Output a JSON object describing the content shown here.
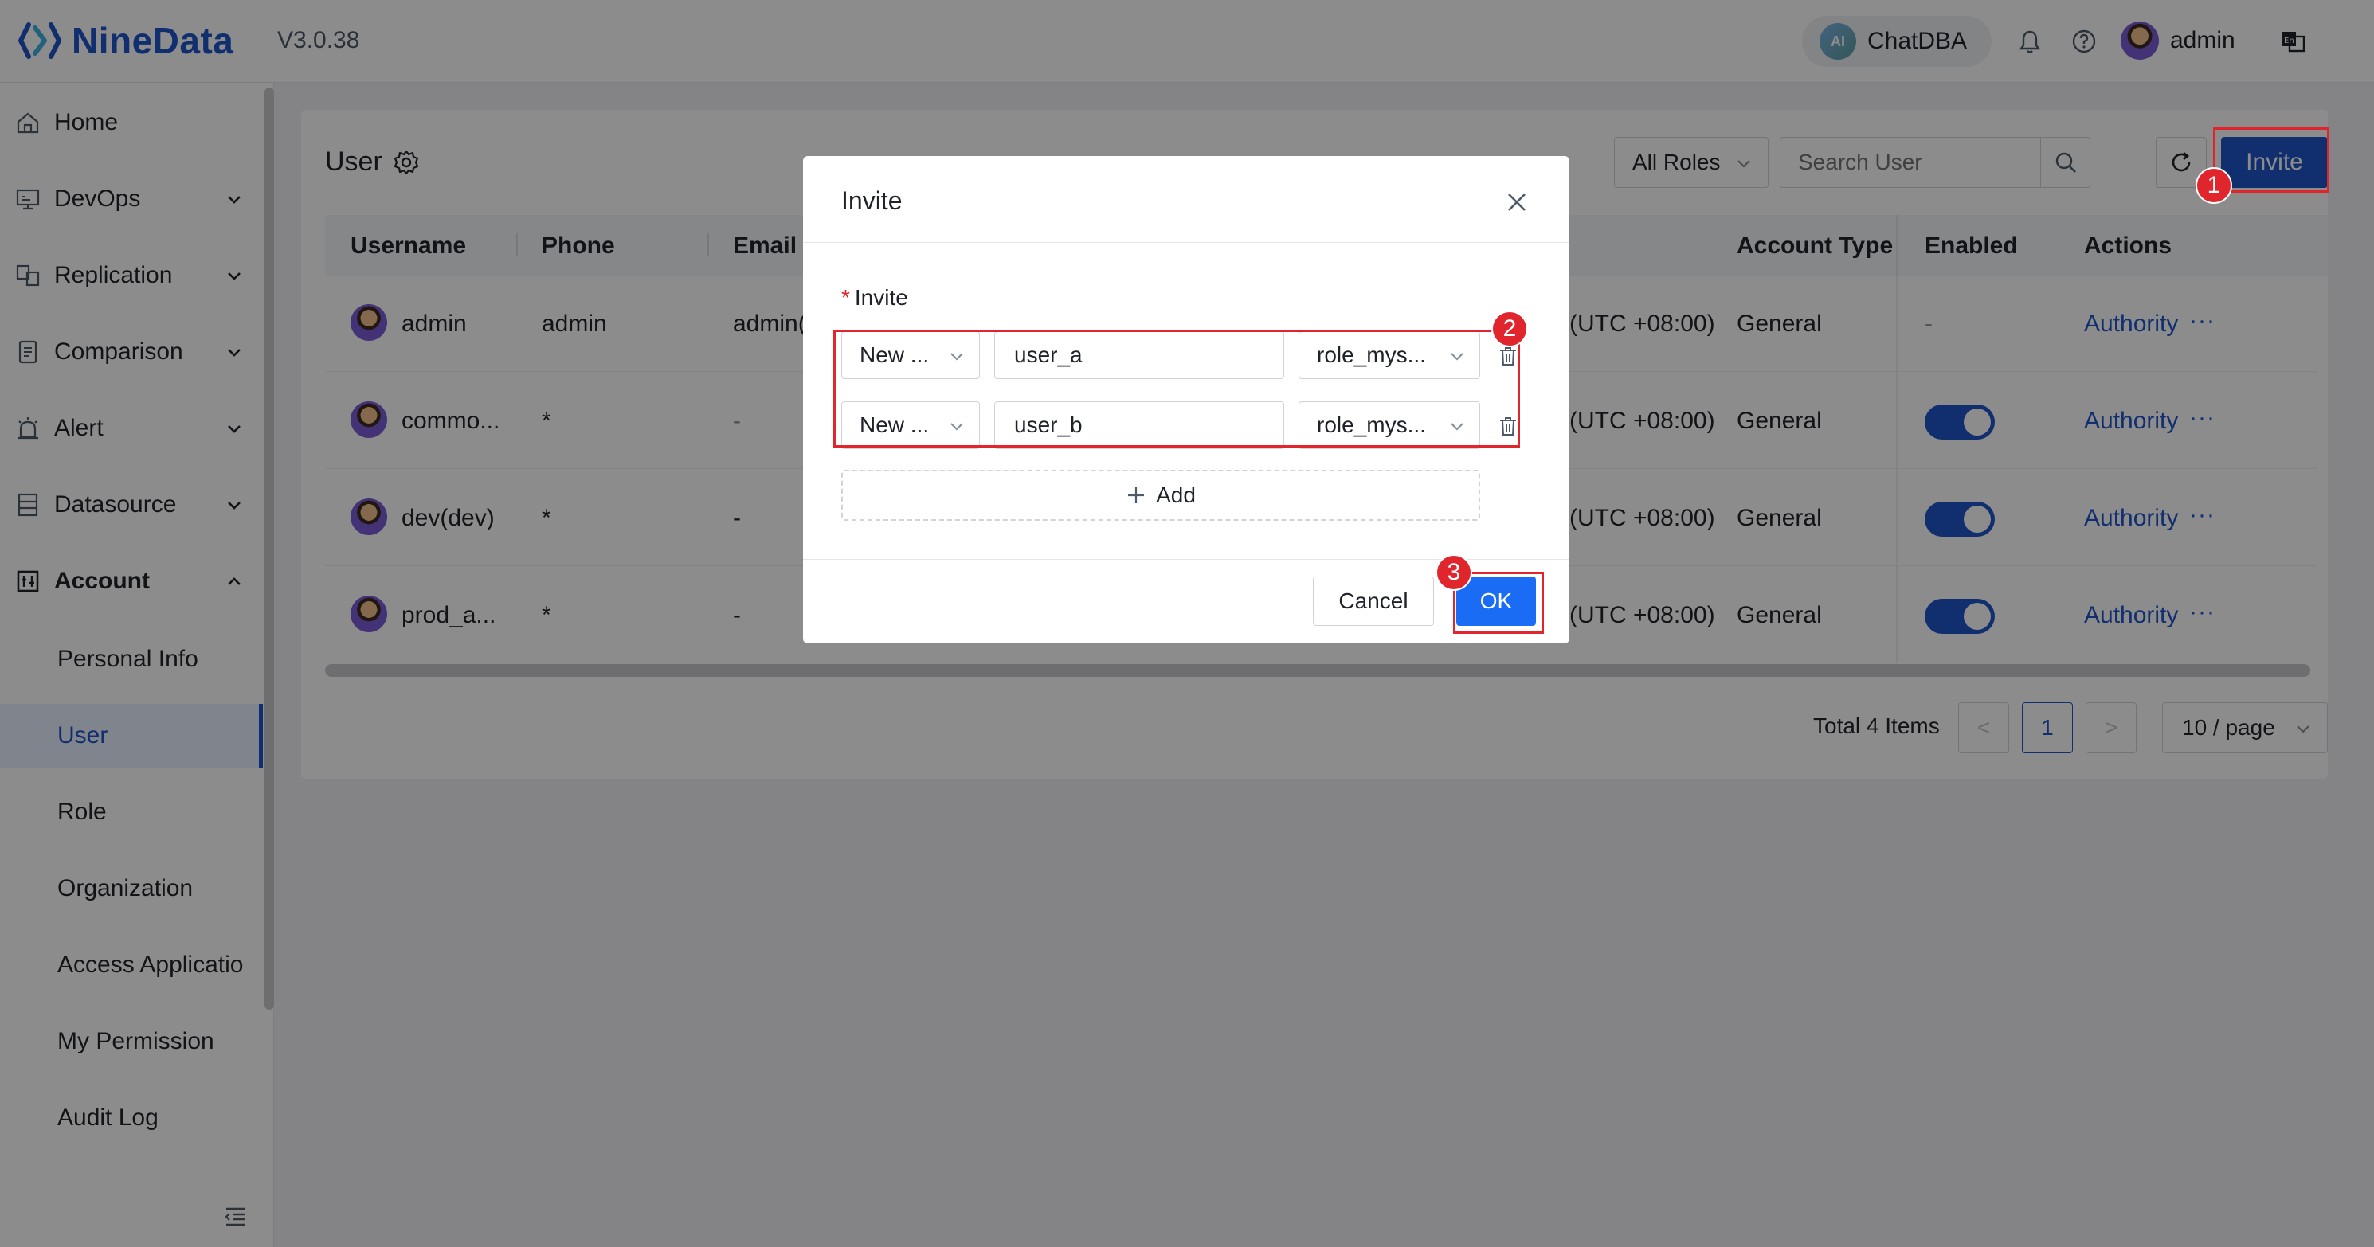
{
  "app": {
    "name": "NineData",
    "version": "V3.0.38",
    "chatdba_badge": "AI",
    "chatdba_label": "ChatDBA",
    "user": "admin",
    "accent": "#1f54c9"
  },
  "sidebar": {
    "items": [
      {
        "label": "Home",
        "icon": "home-icon"
      },
      {
        "label": "DevOps",
        "icon": "monitor-icon"
      },
      {
        "label": "Replication",
        "icon": "replication-icon"
      },
      {
        "label": "Comparison",
        "icon": "comparison-icon"
      },
      {
        "label": "Alert",
        "icon": "alarm-icon"
      },
      {
        "label": "Datasource",
        "icon": "database-icon"
      },
      {
        "label": "Account",
        "icon": "account-icon"
      }
    ],
    "account_sub": [
      "Personal Info",
      "User",
      "Role",
      "Organization",
      "Access Applicatio",
      "My Permission",
      "Audit Log"
    ],
    "active_sub": "User"
  },
  "page": {
    "title": "User",
    "roles_filter": "All Roles",
    "search_placeholder": "Search User",
    "invite_label": "Invite"
  },
  "table": {
    "headers": {
      "username": "Username",
      "phone": "Phone",
      "email": "Email",
      "account_type": "Account Type",
      "enabled": "Enabled",
      "actions": "Actions"
    },
    "rows": [
      {
        "username": "admin",
        "phone": "admin",
        "email": "admin(",
        "time": "(UTC +08:00)",
        "account_type": "General",
        "enabled": "-",
        "action": "Authority",
        "more": "···"
      },
      {
        "username": "commo...",
        "phone": "*",
        "email": "-",
        "time": "(UTC +08:00)",
        "account_type": "General",
        "enabled": true,
        "action": "Authority",
        "more": "···"
      },
      {
        "username": "dev(dev)",
        "phone": "*",
        "email": "-",
        "time": "(UTC +08:00)",
        "account_type": "General",
        "enabled": true,
        "action": "Authority",
        "more": "···"
      },
      {
        "username": "prod_a...",
        "phone": "*",
        "email": "-",
        "time": "(UTC +08:00)",
        "account_type": "General",
        "enabled": true,
        "action": "Authority",
        "more": "···"
      }
    ]
  },
  "pagination": {
    "total": "Total 4 Items",
    "prev": "<",
    "current": "1",
    "next": ">",
    "page_size": "10 / page"
  },
  "modal": {
    "title": "Invite",
    "field_required": "*",
    "field_label": "Invite",
    "rows": [
      {
        "type": "New ...",
        "username": "user_a",
        "role": "role_mys..."
      },
      {
        "type": "New ...",
        "username": "user_b",
        "role": "role_mys..."
      }
    ],
    "add_label": "Add",
    "cancel_label": "Cancel",
    "ok_label": "OK"
  },
  "annotations": {
    "marker_1": "1",
    "marker_2": "2",
    "marker_3": "3",
    "color": "#e0262c"
  }
}
